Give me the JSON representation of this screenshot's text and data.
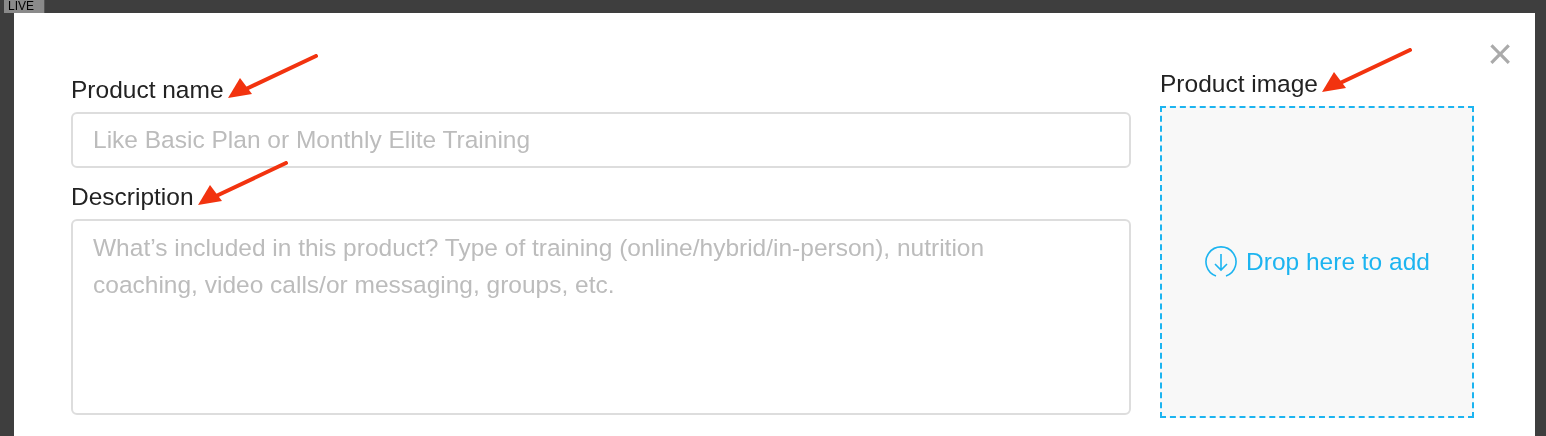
{
  "background": {
    "tab_label": "LIVE"
  },
  "dialog": {
    "close": "×",
    "fields": [
      {
        "kind": "input",
        "label": "Product name",
        "placeholder": "Like Basic Plan or Monthly Elite Training",
        "annotated": true
      },
      {
        "kind": "textarea",
        "label": "Description",
        "placeholder": "What’s included in this product? Type of training (online/hybrid/in-person), nutrition coaching, video calls/or messaging, groups, etc.",
        "annotated": true
      }
    ],
    "image": {
      "label": "Product image",
      "drop_text": "Drop here to add",
      "annotated": true
    }
  }
}
